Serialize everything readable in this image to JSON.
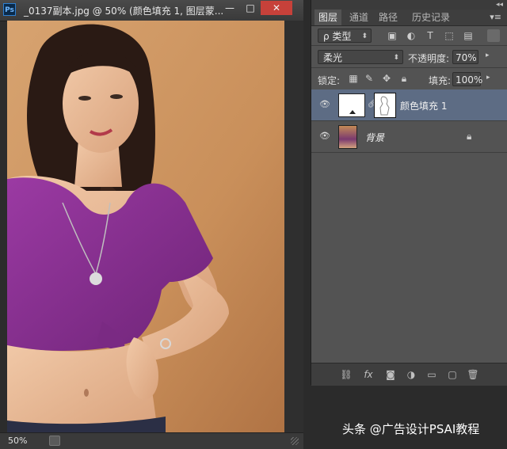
{
  "document": {
    "app_badge": "Ps",
    "title": "_0137副本.jpg @ 50% (颜色填充 1, 图层蒙...",
    "min_symbol": "—",
    "max_symbol": "□",
    "close_symbol": "✕",
    "zoom": "50%"
  },
  "panel": {
    "collapse_arrows": "◂◂",
    "menu_symbol": "▾≡",
    "tabs": [
      {
        "label": "图层",
        "active": true
      },
      {
        "label": "通道",
        "active": false
      },
      {
        "label": "路径",
        "active": false
      },
      {
        "label": "历史记录",
        "active": false
      }
    ],
    "filter": {
      "value": "ρ 类型"
    },
    "blend_mode": {
      "value": "柔光"
    },
    "opacity": {
      "label": "不透明度:",
      "value": "70%"
    },
    "lock": {
      "label": "锁定:"
    },
    "fill": {
      "label": "填充:",
      "value": "100%"
    },
    "layers": [
      {
        "name": "颜色填充 1",
        "visible": true,
        "selected": true
      },
      {
        "name": "背景",
        "visible": true,
        "selected": false,
        "locked": true
      }
    ]
  },
  "colors": {
    "panel_bg": "#535353",
    "selected_layer": "#5d6c84",
    "close_button": "#c7413a"
  },
  "watermark": "头条 @广告设计PSAI教程"
}
